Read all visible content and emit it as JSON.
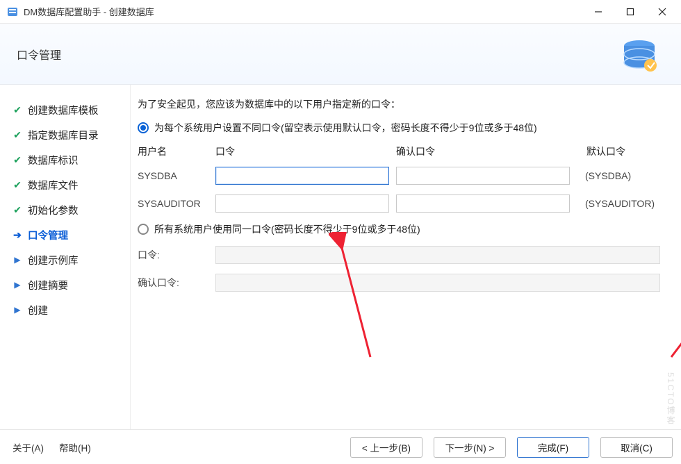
{
  "window": {
    "title": "DM数据库配置助手 - 创建数据库"
  },
  "header": {
    "page_title": "口令管理"
  },
  "sidebar": {
    "items": [
      {
        "label": "创建数据库模板",
        "state": "done"
      },
      {
        "label": "指定数据库目录",
        "state": "done"
      },
      {
        "label": "数据库标识",
        "state": "done"
      },
      {
        "label": "数据库文件",
        "state": "done"
      },
      {
        "label": "初始化参数",
        "state": "done"
      },
      {
        "label": "口令管理",
        "state": "current"
      },
      {
        "label": "创建示例库",
        "state": "pending"
      },
      {
        "label": "创建摘要",
        "state": "pending"
      },
      {
        "label": "创建",
        "state": "pending"
      }
    ]
  },
  "content": {
    "intro": "为了安全起见，您应该为数据库中的以下用户指定新的口令：",
    "radio1": "为每个系统用户设置不同口令(留空表示使用默认口令，密码长度不得少于9位或多于48位)",
    "cols": {
      "user": "用户名",
      "pass": "口令",
      "confirm": "确认口令",
      "def": "默认口令"
    },
    "rows": [
      {
        "user": "SYSDBA",
        "pass": "",
        "confirm": "",
        "def": "(SYSDBA)"
      },
      {
        "user": "SYSAUDITOR",
        "pass": "",
        "confirm": "",
        "def": "(SYSAUDITOR)"
      }
    ],
    "radio2": "所有系统用户使用同一口令(密码长度不得少于9位或多于48位)",
    "shared_pass_label": "口令:",
    "shared_confirm_label": "确认口令:"
  },
  "footer": {
    "about": "关于(A)",
    "help": "帮助(H)",
    "prev": "< 上一步(B)",
    "next": "下一步(N) >",
    "finish": "完成(F)",
    "cancel": "取消(C)"
  },
  "watermark": "51CTO博客"
}
